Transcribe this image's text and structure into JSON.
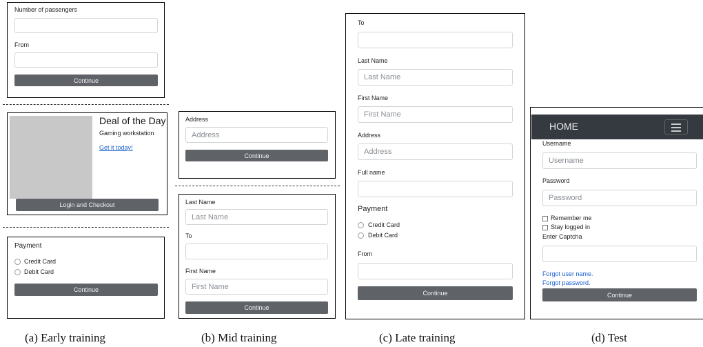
{
  "panel_a1": {
    "passengers_label": "Number of passengers",
    "from_label": "From",
    "continue_label": "Continue"
  },
  "panel_a2": {
    "title": "Deal of the Day",
    "subtitle": "Gaming workstation",
    "link": "Get it today!",
    "checkout_label": "Login and Checkout"
  },
  "panel_a3": {
    "payment_label": "Payment",
    "options": [
      "Credit Card",
      "Debit Card"
    ],
    "continue_label": "Continue"
  },
  "panel_b1": {
    "address_label": "Address",
    "address_placeholder": "Address",
    "continue_label": "Continue"
  },
  "panel_b2": {
    "last_name_label": "Last Name",
    "last_name_placeholder": "Last Name",
    "to_label": "To",
    "first_name_label": "First Name",
    "first_name_placeholder": "First Name",
    "continue_label": "Continue"
  },
  "panel_c": {
    "to_label": "To",
    "last_name_label": "Last Name",
    "last_name_placeholder": "Last Name",
    "first_name_label": "First Name",
    "first_name_placeholder": "First Name",
    "address_label": "Address",
    "address_placeholder": "Address",
    "full_name_label": "Full name",
    "payment_label": "Payment",
    "options": [
      "Credit Card",
      "Debit Card"
    ],
    "from_label": "From",
    "continue_label": "Continue"
  },
  "panel_d": {
    "nav_home": "HOME",
    "username_label": "Username",
    "username_placeholder": "Username",
    "password_label": "Password",
    "password_placeholder": "Password",
    "remember_me": "Remember me",
    "stay_logged_in": "Stay logged in",
    "captcha_label": "Enter Captcha",
    "forgot_username": "Forgot user name.",
    "forgot_password": "Forgot password.",
    "continue_label": "Continue"
  },
  "captions": {
    "a": "(a) Early training",
    "b": "(b) Mid training",
    "c": "(c) Late training",
    "d": "(d) Test"
  },
  "colors": {
    "button": "#5f6368",
    "navbar": "#343a40",
    "link": "#1a5fd0",
    "image_placeholder": "#c8c8c8"
  }
}
